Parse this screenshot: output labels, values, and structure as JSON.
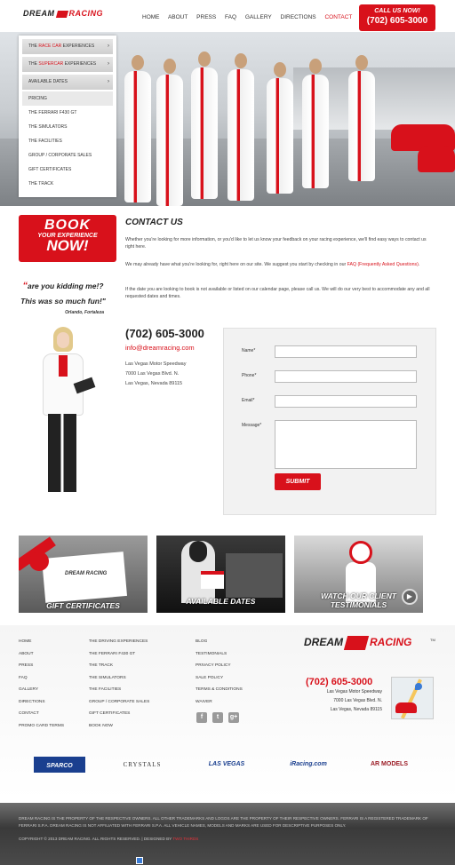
{
  "header": {
    "logo_dream": "DREAM",
    "logo_racing": "RACING",
    "nav": [
      "HOME",
      "ABOUT",
      "PRESS",
      "FAQ",
      "GALLERY",
      "DIRECTIONS",
      "CONTACT"
    ],
    "nav_active": "CONTACT",
    "call_label": "CALL US NOW!",
    "call_phone": "(702) 605-3000"
  },
  "side_menu": {
    "items_dark": [
      {
        "prefix": "THE ",
        "highlight": "RACE CAR",
        "suffix": " EXPERIENCES",
        "arrow": "›"
      },
      {
        "prefix": "THE ",
        "highlight": "SUPERCAR",
        "suffix": " EXPERIENCES",
        "arrow": "›"
      },
      {
        "prefix": "AVAILABLE DATES",
        "highlight": "",
        "suffix": "",
        "arrow": "›"
      }
    ],
    "pricing": "PRICING",
    "items": [
      "THE FERRARI F430 GT",
      "THE SIMULATORS",
      "THE FACILITIES",
      "GROUP / CORPORATE SALES",
      "GIFT CERTIFICATES",
      "THE TRACK"
    ]
  },
  "book": {
    "line1": "BOOK",
    "line2": "YOUR EXPERIENCE",
    "line3": "NOW!"
  },
  "testimonial": {
    "line1": "are you kidding me!?",
    "line2": "This was so much fun!\"",
    "author": "Orlando, Fortaleza"
  },
  "contact": {
    "title": "CONTACT US",
    "p1": "Whether you're looking for more information, or you'd like to let us know your feedback on your racing experience, we'll find easy ways to contact us right here.",
    "p2_pre": "We may already have what you're looking for, right here on our site.  We suggest you start by checking in our ",
    "p2_link": "FAQ (Frequently Asked Questions)",
    "p2_post": ".",
    "p3": "If the date you are looking to book is not available or listed on our calendar page, please call us. We will do our very best to accommodate any and all requested dates and times.",
    "phone": "(702) 605-3000",
    "email": "info@dreamracing.com",
    "address": [
      "Las Vegas Motor Speedway",
      "7000 Las Vegas Blvd. N.",
      "Las Vegas, Nevada 89115"
    ]
  },
  "form": {
    "name_label": "Name*",
    "phone_label": "Phone*",
    "email_label": "Email*",
    "message_label": "Message*",
    "submit": "SUBMIT"
  },
  "tiles": {
    "gift": "GIFT CERTIFICATES",
    "dates": "AVAILABLE DATES",
    "testimonials_1": "WATCH OUR CLIENT",
    "testimonials_2": "TESTIMONIALS",
    "envelope_logo": "DREAM RACING"
  },
  "footer": {
    "col1": [
      "HOME",
      "ABOUT",
      "PRESS",
      "FAQ",
      "GALLERY",
      "DIRECTIONS",
      "CONTACT",
      "PROMO CARD TERMS"
    ],
    "col2": [
      "THE DRIVING EXPERIENCES",
      "THE FERRARI F430 GT",
      "THE TRACK",
      "THE SIMULATORS",
      "THE FACILITIES",
      "GROUP / CORPORATE SALES",
      "GIFT CERTIFICATES",
      "BOOK NOW"
    ],
    "col3": [
      "BLOG",
      "TESTIMONIALS",
      "PRIVACY POLICY",
      "SALE POLICY",
      "TERMS & CONDITIONS",
      "WAIVER"
    ],
    "social": [
      "f",
      "t",
      "g+"
    ],
    "logo_dream": "DREAM",
    "logo_racing": "RACING",
    "tm": "TM",
    "phone": "(702) 605-3000",
    "address": [
      "Las Vegas Motor Speedway",
      "7000 Las Vegas Blvd. N.",
      "Las Vegas, Nevada 89115"
    ]
  },
  "partners": [
    "SPARCO",
    "CRYSTALS",
    "LAS VEGAS",
    "iRacing.com",
    "AR MODELS"
  ],
  "legal": {
    "text": "DREAM RACING IS THE PROPERTY OF THE RESPECTIVE OWNERS. ALL OTHER TRADEMARKS AND LOGOS ARE THE PROPERTY OF THEIR RESPECTIVE OWNERS. FERRARI IS A REGISTERED TRADEMARK OF FERRARI S.P.A. DREAM RACING IS NOT AFFILIATED WITH FERRARI S.P.A. ALL VEHICLE NAMES, MODELS AND MARKS ARE USED FOR DESCRIPTIVE PURPOSES ONLY.",
    "copyright": "COPYRIGHT © 2013 DREAM RACING. ALL RIGHTS RESERVED. | DESIGNED BY",
    "designer": "TWO THIRDS"
  },
  "colors": {
    "accent": "#d8111b",
    "dark": "#222222",
    "form_bg": "#f2f2f2"
  }
}
